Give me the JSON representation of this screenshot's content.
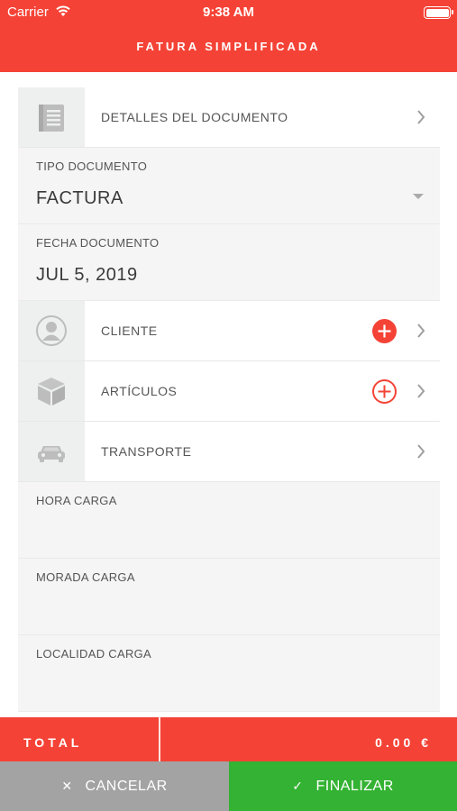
{
  "status_bar": {
    "carrier": "Carrier",
    "time": "9:38 AM"
  },
  "header": {
    "title": "FATURA SIMPLIFICADA"
  },
  "colors": {
    "accent": "#f44336",
    "finish": "#34b233",
    "cancel": "#a3a3a3"
  },
  "rows": {
    "document_details": {
      "label": "DETALLES DEL DOCUMENTO",
      "icon": "document-icon"
    },
    "customer": {
      "label": "CLIENTE",
      "icon": "person-icon"
    },
    "articles": {
      "label": "ARTÍCULOS",
      "icon": "box-icon"
    },
    "transport": {
      "label": "TRANSPORTE",
      "icon": "car-icon"
    }
  },
  "fields": {
    "doc_type": {
      "label": "TIPO DOCUMENTO",
      "value": "FACTURA"
    },
    "doc_date": {
      "label": "FECHA DOCUMENTO",
      "value": "JUL 5, 2019"
    },
    "load_time": {
      "label": "HORA CARGA",
      "value": ""
    },
    "load_address": {
      "label": "MORADA CARGA",
      "value": ""
    },
    "load_city": {
      "label": "LOCALIDAD CARGA",
      "value": ""
    }
  },
  "total": {
    "label": "TOTAL",
    "value": "0.00 €"
  },
  "actions": {
    "cancel": "CANCELAR",
    "finish": "FINALIZAR"
  }
}
